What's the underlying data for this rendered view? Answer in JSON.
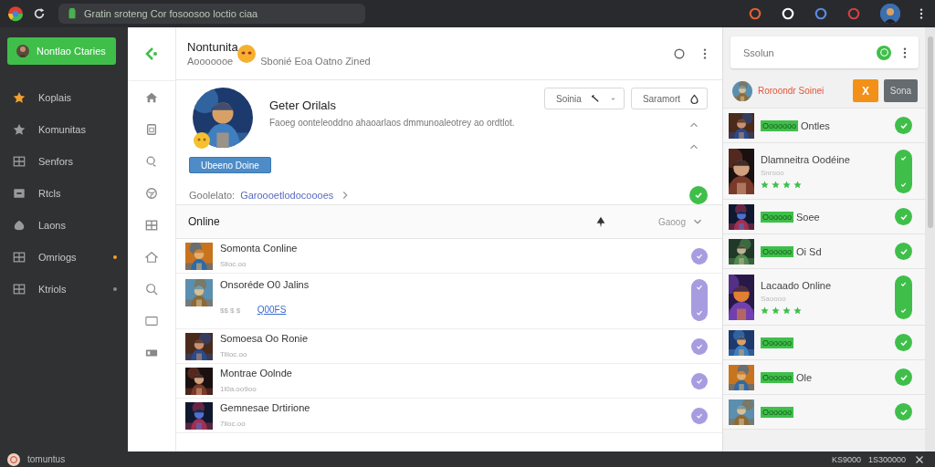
{
  "browser": {
    "address": "Gratin sroteng Cor fosoosoo loctio ciaa"
  },
  "sidebar": {
    "primary_button": "Nontlao Ctaries",
    "items": [
      {
        "label": "Koplais"
      },
      {
        "label": "Komunitas"
      },
      {
        "label": "Senfors"
      },
      {
        "label": "Rtcls"
      },
      {
        "label": "Laons"
      },
      {
        "label": "Omriogs",
        "color": "#f0a030"
      },
      {
        "label": "Ktriols",
        "color": "#8a8a8a"
      }
    ]
  },
  "header": {
    "title": "Nontunita",
    "subtitle_left": "Aooooooe",
    "subtitle_right": "Sbonié Eoa Oatno Zined"
  },
  "profile": {
    "name": "Geter Orilals",
    "description": "Faoeg oonteleoddno ahaoarlaos dmmunoaleotrey ao ordtlot.",
    "buttons": [
      "Soinia",
      "Saramort"
    ],
    "action": "Ubeeno Doine",
    "link_label": "Goolelato:",
    "link": "Garoooetlodocoooes"
  },
  "online": {
    "title": "Online",
    "sort": "Gaoog",
    "rows": [
      {
        "name": "Somonta Conline",
        "meta": "Slioc.oo"
      },
      {
        "name": "Onsoréde O0 Jalins",
        "meta": "$$ $ $",
        "link": "Q00FS"
      },
      {
        "name": "Somoesa Oo Ronie",
        "meta": "Tilioc.oo"
      },
      {
        "name": "Montrae Oolnde",
        "meta": "1l0a.oo9oo"
      },
      {
        "name": "Gemnesae Drtirione",
        "meta": "7lioc.oo"
      }
    ]
  },
  "panel": {
    "search_placeholder": "Ssolun",
    "header": {
      "name": "Roroondr Soinei",
      "close": "X",
      "button": "Sona"
    },
    "items": [
      {
        "tag": "Ooooooo",
        "name": "Ontles"
      },
      {
        "name": "Dlamneitra Oodéine",
        "meta": "Snrooo",
        "stars": 4
      },
      {
        "tag": "Oooooo",
        "name": "Soee"
      },
      {
        "tag": "Oooooo",
        "name": "Oi Sd"
      },
      {
        "name": "Lacaado Online",
        "meta": "Saoooo",
        "stars": 4
      },
      {
        "tag": "Oooooo"
      },
      {
        "tag": "Oooooo",
        "name": "Ole"
      },
      {
        "tag": "Oooooo"
      }
    ]
  },
  "status_bar": {
    "left": "tomuntus",
    "right_1": "KS9000",
    "right_2": "1S300000"
  }
}
